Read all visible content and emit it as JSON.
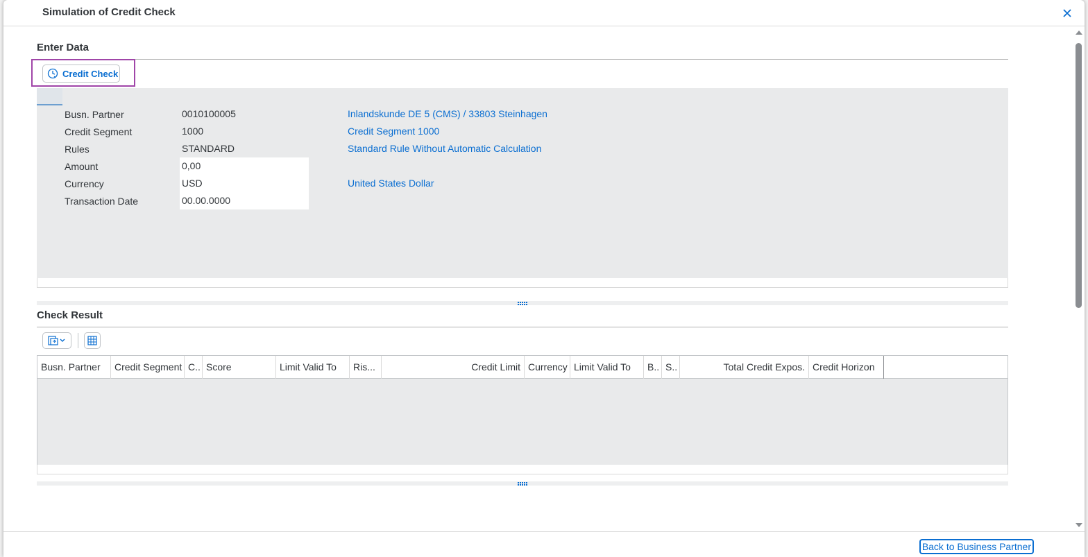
{
  "dialog": {
    "title": "Simulation of Credit Check",
    "close_icon": "close-icon"
  },
  "enter_data": {
    "title": "Enter Data",
    "credit_check_button": "Credit Check",
    "fields": [
      {
        "label": "Busn. Partner",
        "value": "0010100005",
        "description": "Inlandskunde DE 5 (CMS) / 33803 Steinhagen",
        "editable": false
      },
      {
        "label": "Credit Segment",
        "value": "1000",
        "description": "Credit Segment 1000",
        "editable": false
      },
      {
        "label": "Rules",
        "value": "STANDARD",
        "description": "Standard Rule Without Automatic Calculation",
        "editable": false
      },
      {
        "label": "Amount",
        "value": "0,00",
        "description": "",
        "editable": true
      },
      {
        "label": "Currency",
        "value": "USD",
        "description": "United States Dollar",
        "editable": true
      },
      {
        "label": "Transaction Date",
        "value": "00.00.0000",
        "description": "",
        "editable": true
      }
    ]
  },
  "check_result": {
    "title": "Check Result",
    "toolbar": {
      "export_icon": "export-icon",
      "layout_icon": "grid-settings-icon"
    },
    "columns": [
      {
        "label": "Busn. Partner",
        "align": "left"
      },
      {
        "label": "Credit Segment",
        "align": "left"
      },
      {
        "label": "C..",
        "align": "left"
      },
      {
        "label": "Score",
        "align": "left"
      },
      {
        "label": "Limit Valid To",
        "align": "left"
      },
      {
        "label": "Ris...",
        "align": "left"
      },
      {
        "label": "Credit Limit",
        "align": "right"
      },
      {
        "label": "Currency",
        "align": "left"
      },
      {
        "label": "Limit Valid To",
        "align": "left"
      },
      {
        "label": "B..",
        "align": "left"
      },
      {
        "label": "S..",
        "align": "left"
      },
      {
        "label": "Total Credit Expos.",
        "align": "right"
      },
      {
        "label": "Credit Horizon",
        "align": "left"
      }
    ],
    "rows": []
  },
  "footer": {
    "back_button": "Back to Business Partner"
  },
  "colors": {
    "accent": "#0a6ed1",
    "highlight_border": "#a045a8",
    "panel_bg": "#e9eaeb"
  }
}
